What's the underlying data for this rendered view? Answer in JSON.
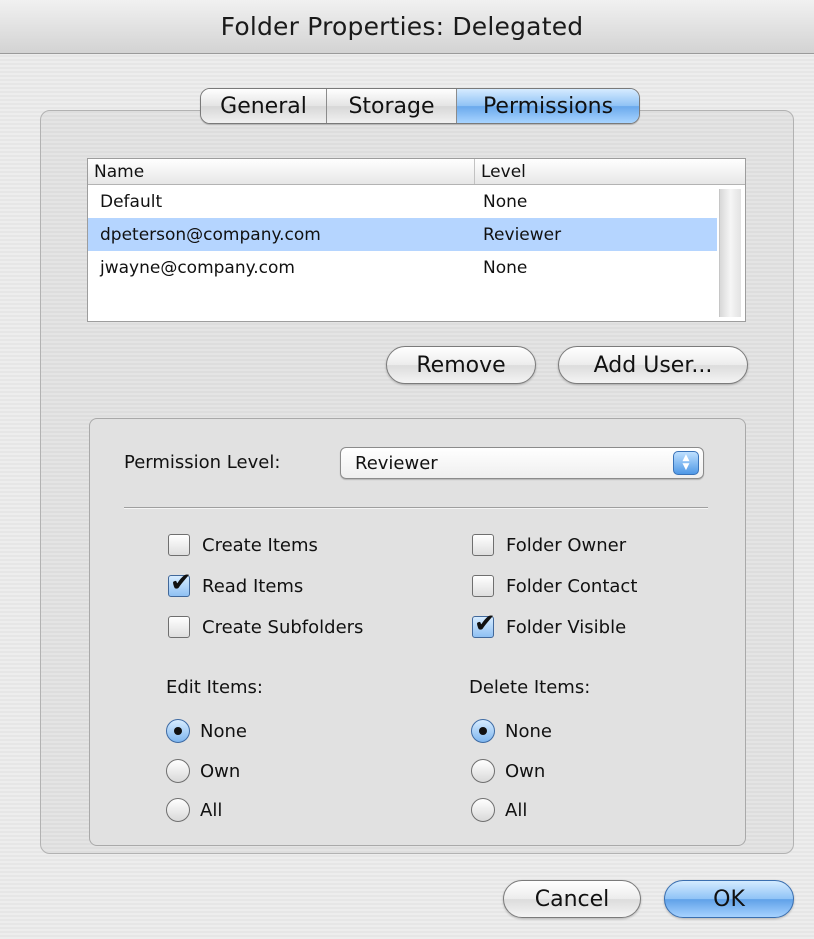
{
  "window": {
    "title": "Folder Properties: Delegated"
  },
  "tabs": [
    {
      "label": "General",
      "selected": false
    },
    {
      "label": "Storage",
      "selected": false
    },
    {
      "label": "Permissions",
      "selected": true
    }
  ],
  "users_table": {
    "headers": {
      "name": "Name",
      "level": "Level"
    },
    "rows": [
      {
        "name": "Default",
        "level": "None",
        "selected": false
      },
      {
        "name": "dpeterson@company.com",
        "level": "Reviewer",
        "selected": true
      },
      {
        "name": "jwayne@company.com",
        "level": "None",
        "selected": false
      }
    ]
  },
  "buttons": {
    "remove": "Remove",
    "add_user": "Add User...",
    "cancel": "Cancel",
    "ok": "OK"
  },
  "permission": {
    "label": "Permission Level:",
    "selected_level": "Reviewer"
  },
  "checkboxes": {
    "create_items": {
      "label": "Create Items",
      "checked": false
    },
    "read_items": {
      "label": "Read Items",
      "checked": true
    },
    "create_subfolders": {
      "label": "Create Subfolders",
      "checked": false
    },
    "folder_owner": {
      "label": "Folder Owner",
      "checked": false
    },
    "folder_contact": {
      "label": "Folder Contact",
      "checked": false
    },
    "folder_visible": {
      "label": "Folder Visible",
      "checked": true
    }
  },
  "edit_items": {
    "label": "Edit Items:",
    "options": [
      "None",
      "Own",
      "All"
    ],
    "selected": "None"
  },
  "delete_items": {
    "label": "Delete Items:",
    "options": [
      "None",
      "Own",
      "All"
    ],
    "selected": "None"
  },
  "colors": {
    "accent": "#6aa9ec",
    "selection": "#b5d5ff"
  }
}
